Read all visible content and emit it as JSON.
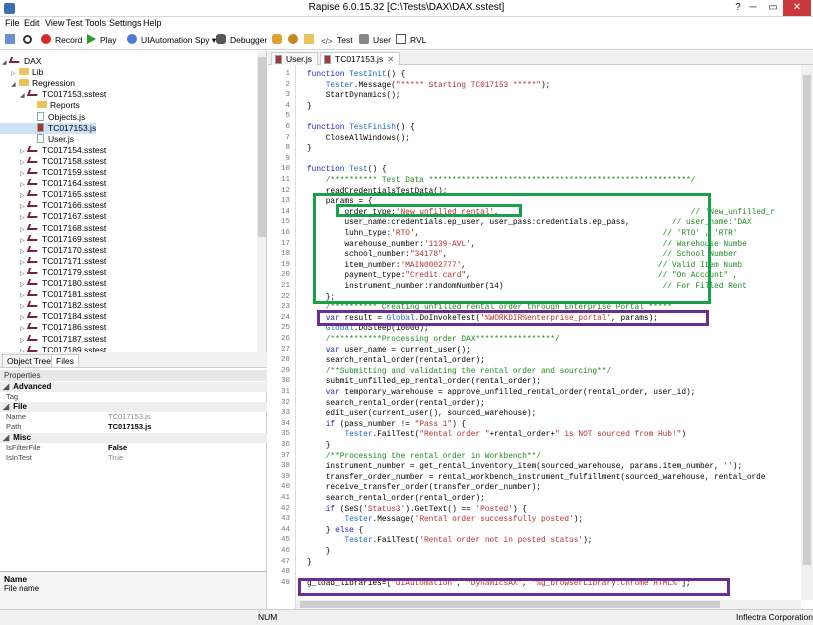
{
  "window": {
    "title": "Rapise 6.0.15.32 [C:\\Tests\\DAX\\DAX.sstest]",
    "min": "─",
    "restore": "▭",
    "close": "✕",
    "help": "?",
    "accent": "#1aa04a"
  },
  "menu": [
    "File",
    "Edit",
    "View",
    "Test",
    "Tools",
    "Settings",
    "Help"
  ],
  "toolbar": {
    "record": "Record",
    "play": "Play",
    "spy": "UIAutomation Spy",
    "debugger": "Debugger",
    "test": "Test",
    "user": "User",
    "rvl": "RVL"
  },
  "tree": [
    {
      "label": "DAX",
      "type": "test",
      "indent": 0,
      "arrow": "◢"
    },
    {
      "label": "Lib",
      "type": "folder",
      "indent": 1,
      "arrow": "▷"
    },
    {
      "label": "Regression",
      "type": "folder",
      "indent": 1,
      "arrow": "◢"
    },
    {
      "label": "TC017153.sstest",
      "type": "test",
      "indent": 2,
      "arrow": "◢"
    },
    {
      "label": "Reports",
      "type": "folder",
      "indent": 3,
      "arrow": ""
    },
    {
      "label": "Objects.js",
      "type": "file",
      "indent": 3,
      "arrow": ""
    },
    {
      "label": "TC017153.js",
      "type": "js",
      "indent": 3,
      "arrow": "",
      "selected": true
    },
    {
      "label": "User.js",
      "type": "file",
      "indent": 3,
      "arrow": ""
    },
    {
      "label": "TC017154.sstest",
      "type": "test",
      "indent": 2,
      "arrow": "▷"
    },
    {
      "label": "TC017158.sstest",
      "type": "test",
      "indent": 2,
      "arrow": "▷"
    },
    {
      "label": "TC017159.sstest",
      "type": "test",
      "indent": 2,
      "arrow": "▷"
    },
    {
      "label": "TC017164.sstest",
      "type": "test",
      "indent": 2,
      "arrow": "▷"
    },
    {
      "label": "TC017165.sstest",
      "type": "test",
      "indent": 2,
      "arrow": "▷"
    },
    {
      "label": "TC017166.sstest",
      "type": "test",
      "indent": 2,
      "arrow": "▷"
    },
    {
      "label": "TC017167.sstest",
      "type": "test",
      "indent": 2,
      "arrow": "▷"
    },
    {
      "label": "TC017168.sstest",
      "type": "test",
      "indent": 2,
      "arrow": "▷"
    },
    {
      "label": "TC017169.sstest",
      "type": "test",
      "indent": 2,
      "arrow": "▷"
    },
    {
      "label": "TC017170.sstest",
      "type": "test",
      "indent": 2,
      "arrow": "▷"
    },
    {
      "label": "TC017171.sstest",
      "type": "test",
      "indent": 2,
      "arrow": "▷"
    },
    {
      "label": "TC017179.sstest",
      "type": "test",
      "indent": 2,
      "arrow": "▷"
    },
    {
      "label": "TC017180.sstest",
      "type": "test",
      "indent": 2,
      "arrow": "▷"
    },
    {
      "label": "TC017181.sstest",
      "type": "test",
      "indent": 2,
      "arrow": "▷"
    },
    {
      "label": "TC017182.sstest",
      "type": "test",
      "indent": 2,
      "arrow": "▷"
    },
    {
      "label": "TC017184.sstest",
      "type": "test",
      "indent": 2,
      "arrow": "▷"
    },
    {
      "label": "TC017186.sstest",
      "type": "test",
      "indent": 2,
      "arrow": "▷"
    },
    {
      "label": "TC017187.sstest",
      "type": "test",
      "indent": 2,
      "arrow": "▷"
    },
    {
      "label": "TC017189.sstest",
      "type": "test",
      "indent": 2,
      "arrow": "▷"
    }
  ],
  "bottom_tabs": [
    "Object Tree",
    "Files"
  ],
  "properties": {
    "header": "Properties",
    "rows": [
      {
        "cat": "Advanced"
      },
      {
        "name": "Tag",
        "value": ""
      },
      {
        "cat": "File"
      },
      {
        "name": "Name",
        "value": "TC017153.js"
      },
      {
        "name": "Path",
        "value": "TC017153.js",
        "bold": true
      },
      {
        "cat": "Misc"
      },
      {
        "name": "IsFilterFile",
        "value": "False",
        "bold": true
      },
      {
        "name": "IsInTest",
        "value": "True"
      }
    ]
  },
  "name_box": {
    "title": "Name",
    "desc": "File name"
  },
  "editor_tabs": [
    "User.js",
    "TC017153.js"
  ],
  "status": {
    "left": "NUM",
    "right": "Inflectra Corporation"
  },
  "code_lines": [
    [
      {
        "t": "function ",
        "c": "kw"
      },
      {
        "t": "TestInit",
        "c": "glob"
      },
      {
        "t": "() {"
      }
    ],
    [
      {
        "t": "    "
      },
      {
        "t": "Tester",
        "c": "glob"
      },
      {
        "t": ".Message("
      },
      {
        "t": "\"***** Starting TC017153 *****\"",
        "c": "str"
      },
      {
        "t": ");"
      }
    ],
    [
      {
        "t": "    StartDynamics();"
      }
    ],
    [
      {
        "t": "}"
      }
    ],
    [
      {
        "t": ""
      }
    ],
    [
      {
        "t": "function ",
        "c": "kw"
      },
      {
        "t": "TestFinish",
        "c": "glob"
      },
      {
        "t": "() {"
      }
    ],
    [
      {
        "t": "    CloseAllWindows();"
      }
    ],
    [
      {
        "t": "}"
      }
    ],
    [
      {
        "t": ""
      }
    ],
    [
      {
        "t": "function ",
        "c": "kw"
      },
      {
        "t": "Test",
        "c": "glob"
      },
      {
        "t": "() {"
      }
    ],
    [
      {
        "t": "    "
      },
      {
        "t": "/********** Test Data ********************************************************/",
        "c": "cm"
      }
    ],
    [
      {
        "t": "    readCredentialsTestData();"
      }
    ],
    [
      {
        "t": "    params = {"
      }
    ],
    [
      {
        "t": "        order_type:"
      },
      {
        "t": "'New_unfilled_rental'",
        "c": "str"
      },
      {
        "t": ",                                         "
      },
      {
        "t": "// 'New_unfilled_r",
        "c": "cm"
      }
    ],
    [
      {
        "t": "        user_name:credentials.ep_user, user_pass:credentials.ep_pass,         "
      },
      {
        "t": "// user_name:'DAX",
        "c": "cm"
      }
    ],
    [
      {
        "t": "        luhn_type:"
      },
      {
        "t": "'RTO'",
        "c": "str"
      },
      {
        "t": ",                                                    "
      },
      {
        "t": "// 'RTO' , 'RTR'",
        "c": "cm"
      }
    ],
    [
      {
        "t": "        warehouse_number:"
      },
      {
        "t": "'1139-AVL'",
        "c": "str"
      },
      {
        "t": ",                                        "
      },
      {
        "t": "// Warehouse Numbe",
        "c": "cm"
      }
    ],
    [
      {
        "t": "        school_number:"
      },
      {
        "t": "\"34178\"",
        "c": "str"
      },
      {
        "t": ",                                              "
      },
      {
        "t": "// School Number",
        "c": "cm"
      }
    ],
    [
      {
        "t": "        item_number:"
      },
      {
        "t": "'MAIN0002777'",
        "c": "str"
      },
      {
        "t": ",                                         "
      },
      {
        "t": "// Valid Item Numb",
        "c": "cm"
      }
    ],
    [
      {
        "t": "        payment_type:"
      },
      {
        "t": "\"Credit card\"",
        "c": "str"
      },
      {
        "t": ",                                        "
      },
      {
        "t": "// \"On Account\" ,",
        "c": "cm"
      }
    ],
    [
      {
        "t": "        instrument_number:randomNumber(14)                                  "
      },
      {
        "t": "// For Filled Rent",
        "c": "cm"
      }
    ],
    [
      {
        "t": "    };"
      }
    ],
    [
      {
        "t": "    "
      },
      {
        "t": "/********** Creating unfilled rental order through Enterprise Portal *****",
        "c": "cm"
      }
    ],
    [
      {
        "t": "    "
      },
      {
        "t": "var ",
        "c": "kw"
      },
      {
        "t": "result = "
      },
      {
        "t": "Global",
        "c": "glob"
      },
      {
        "t": ".DoInvokeTest("
      },
      {
        "t": "'%WORKDIR%enterprise_portal'",
        "c": "str"
      },
      {
        "t": ", params);"
      }
    ],
    [
      {
        "t": "    "
      },
      {
        "t": "Global",
        "c": "glob"
      },
      {
        "t": ".DoSleep(10000);"
      }
    ],
    [
      {
        "t": "    "
      },
      {
        "t": "/***********Processing order DAX*****************/",
        "c": "cm"
      }
    ],
    [
      {
        "t": "    "
      },
      {
        "t": "var ",
        "c": "kw"
      },
      {
        "t": "user_name = current_user();"
      }
    ],
    [
      {
        "t": "    search_rental_order(rental_order);"
      }
    ],
    [
      {
        "t": "    "
      },
      {
        "t": "/**Submitting and validating the rental order and sourcing**/",
        "c": "cm"
      }
    ],
    [
      {
        "t": "    submit_unfilled_ep_rental_order(rental_order);"
      }
    ],
    [
      {
        "t": "    "
      },
      {
        "t": "var ",
        "c": "kw"
      },
      {
        "t": "temporary_warehouse = approve_unfilled_rental_order(rental_order, user_id);"
      }
    ],
    [
      {
        "t": "    search_rental_order(rental_order);"
      }
    ],
    [
      {
        "t": "    edit_user(current_user(), sourced_warehouse);"
      }
    ],
    [
      {
        "t": "    "
      },
      {
        "t": "if ",
        "c": "kw"
      },
      {
        "t": "(pass_number != "
      },
      {
        "t": "\"Pass 1\"",
        "c": "str"
      },
      {
        "t": ") {"
      }
    ],
    [
      {
        "t": "        "
      },
      {
        "t": "Tester",
        "c": "glob"
      },
      {
        "t": ".FailTest("
      },
      {
        "t": "\"Rental order \"",
        "c": "str"
      },
      {
        "t": "+rental_order+"
      },
      {
        "t": "\" is NOT sourced from Hub!\"",
        "c": "str"
      },
      {
        "t": ")"
      }
    ],
    [
      {
        "t": "    }"
      }
    ],
    [
      {
        "t": "    "
      },
      {
        "t": "/**Processing the rental order in Workbench**/",
        "c": "cm"
      }
    ],
    [
      {
        "t": "    instrument_number = get_rental_inventory_item(sourced_warehouse, params.item_number, "
      },
      {
        "t": "''",
        "c": "str"
      },
      {
        "t": ");"
      }
    ],
    [
      {
        "t": "    transfer_order_number = rental_workbench_instrument_fulfillment(sourced_warehouse, rental_orde"
      }
    ],
    [
      {
        "t": "    receive_transfer_order(transfer_order_number);"
      }
    ],
    [
      {
        "t": "    search_rental_order(rental_order);"
      }
    ],
    [
      {
        "t": "    "
      },
      {
        "t": "if ",
        "c": "kw"
      },
      {
        "t": "(SeS("
      },
      {
        "t": "'Status3'",
        "c": "str"
      },
      {
        "t": ").GetText() == "
      },
      {
        "t": "'Posted'",
        "c": "str"
      },
      {
        "t": ") {"
      }
    ],
    [
      {
        "t": "        "
      },
      {
        "t": "Tester",
        "c": "glob"
      },
      {
        "t": ".Message("
      },
      {
        "t": "'Rental order successfully posted'",
        "c": "str"
      },
      {
        "t": ");"
      }
    ],
    [
      {
        "t": "    } "
      },
      {
        "t": "else ",
        "c": "kw"
      },
      {
        "t": "{"
      }
    ],
    [
      {
        "t": "        "
      },
      {
        "t": "Tester",
        "c": "glob"
      },
      {
        "t": ".FailTest("
      },
      {
        "t": "'Rental order not in posted status'",
        "c": "str"
      },
      {
        "t": ");"
      }
    ],
    [
      {
        "t": "    }"
      }
    ],
    [
      {
        "t": "}"
      }
    ],
    [
      {
        "t": ""
      }
    ],
    [
      {
        "t": "g_load_libraries=["
      },
      {
        "t": "\"UIAutomation\"",
        "c": "str"
      },
      {
        "t": ", "
      },
      {
        "t": "\"DynamicsAX\"",
        "c": "str"
      },
      {
        "t": ", "
      },
      {
        "t": "\"%g_browserLibrary:Chrome HTML%\"",
        "c": "str"
      },
      {
        "t": "];"
      }
    ]
  ]
}
